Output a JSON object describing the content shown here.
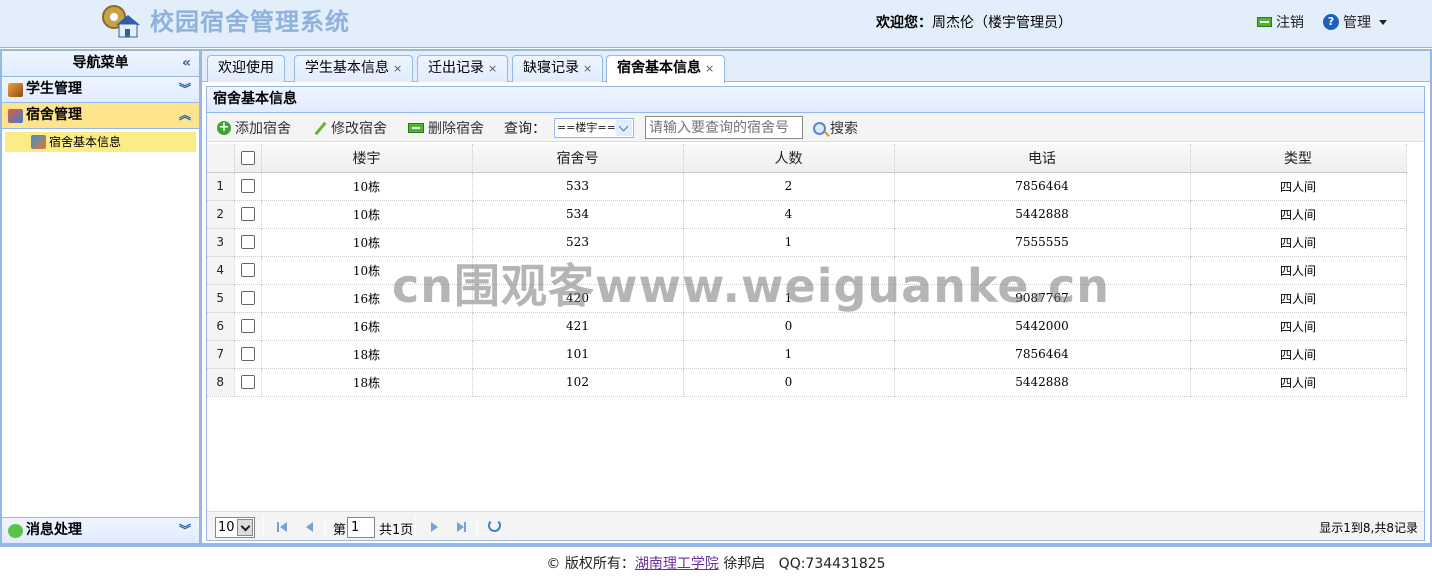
{
  "header": {
    "app_title": "校园宿舍管理系统",
    "welcome_label": "欢迎您：",
    "welcome_user": "周杰伦（楼宇管理员）",
    "logout_label": "注销",
    "manage_label": "管理"
  },
  "nav": {
    "title": "导航菜单",
    "groups": [
      {
        "label": "学生管理",
        "state": "collapsed"
      },
      {
        "label": "宿舍管理",
        "state": "expanded",
        "items": [
          {
            "label": "宿舍基本信息"
          }
        ]
      },
      {
        "label": "消息处理",
        "state": "collapsed"
      }
    ]
  },
  "tabs": [
    {
      "label": "欢迎使用",
      "closable": false
    },
    {
      "label": "学生基本信息",
      "closable": true
    },
    {
      "label": "迁出记录",
      "closable": true
    },
    {
      "label": "缺寝记录",
      "closable": true
    },
    {
      "label": "宿舍基本信息",
      "closable": true,
      "selected": true
    }
  ],
  "panel": {
    "title": "宿舍基本信息",
    "toolbar": {
      "add_label": "添加宿舍",
      "edit_label": "修改宿舍",
      "delete_label": "删除宿舍",
      "query_label": "查询：",
      "building_select_value": "==楼宇==",
      "search_placeholder": "请输入要查询的宿舍号",
      "search_label": "搜索"
    },
    "grid": {
      "columns": [
        "楼宇",
        "宿舍号",
        "人数",
        "电话",
        "类型"
      ],
      "rows": [
        {
          "n": "1",
          "building": "10栋",
          "room": "533",
          "count": "2",
          "phone": "7856464",
          "type": "四人间"
        },
        {
          "n": "2",
          "building": "10栋",
          "room": "534",
          "count": "4",
          "phone": "5442888",
          "type": "四人间"
        },
        {
          "n": "3",
          "building": "10栋",
          "room": "523",
          "count": "1",
          "phone": "7555555",
          "type": "四人间"
        },
        {
          "n": "4",
          "building": "10栋",
          "room": "",
          "count": "",
          "phone": "",
          "type": "四人间"
        },
        {
          "n": "5",
          "building": "16栋",
          "room": "420",
          "count": "1",
          "phone": "9087767",
          "type": "四人间"
        },
        {
          "n": "6",
          "building": "16栋",
          "room": "421",
          "count": "0",
          "phone": "5442000",
          "type": "四人间"
        },
        {
          "n": "7",
          "building": "18栋",
          "room": "101",
          "count": "1",
          "phone": "7856464",
          "type": "四人间"
        },
        {
          "n": "8",
          "building": "18栋",
          "room": "102",
          "count": "0",
          "phone": "5442888",
          "type": "四人间"
        }
      ]
    },
    "pager": {
      "page_size": "10",
      "page_prefix": "第",
      "page_number": "1",
      "page_total": "共1页",
      "info": "显示1到8,共8记录"
    }
  },
  "footer": {
    "copyright_label": "© 版权所有：",
    "school_link": "湖南理工学院",
    "author": "徐邦启",
    "qq": "QQ:734431825"
  },
  "watermark": "cn围观客www.weiguanke.cn",
  "colors": {
    "border": "#95b8e7",
    "header_bg": "#e3eefb",
    "active_nav": "#ffe48d",
    "title_text": "#8fb2dc"
  },
  "icons": [
    "logo-icon",
    "logout-icon",
    "help-icon",
    "collapse-icon",
    "chevron-icon",
    "add-icon",
    "edit-icon",
    "delete-icon",
    "search-icon",
    "first-page-icon",
    "prev-page-icon",
    "next-page-icon",
    "last-page-icon",
    "refresh-icon"
  ]
}
